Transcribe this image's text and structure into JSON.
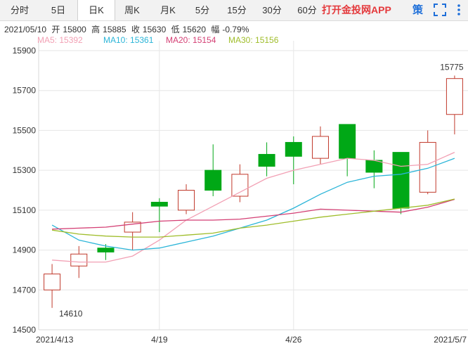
{
  "tabs": [
    {
      "label": "分时",
      "active": false
    },
    {
      "label": "5日",
      "active": false
    },
    {
      "label": "日K",
      "active": true
    },
    {
      "label": "周K",
      "active": false
    },
    {
      "label": "月K",
      "active": false
    },
    {
      "label": "5分",
      "active": false
    },
    {
      "label": "15分",
      "active": false
    },
    {
      "label": "30分",
      "active": false
    },
    {
      "label": "60分",
      "active": false
    }
  ],
  "promo_label": "打开金投网APP",
  "side_icon_text": "策",
  "info": {
    "date": "2021/05/10",
    "open_label": "开",
    "open": "15800",
    "high_label": "高",
    "high": "15885",
    "close_label": "收",
    "close": "15630",
    "low_label": "低",
    "low": "15620",
    "change_label": "幅",
    "change": "-0.79%"
  },
  "ma_legend": [
    {
      "label": "MA5: 15392",
      "color": "#f2a0b4"
    },
    {
      "label": "MA10: 15361",
      "color": "#2bb5d8"
    },
    {
      "label": "MA20: 15154",
      "color": "#d43f74"
    },
    {
      "label": "MA30: 15156",
      "color": "#9fbd2a"
    }
  ],
  "colors": {
    "up": "#c0392b",
    "down": "#00a816",
    "grid": "#e6e6e6",
    "axis_text": "#333333"
  },
  "chart_data": {
    "type": "candlestick",
    "ylim": [
      14500,
      15900
    ],
    "yticks": [
      14500,
      14700,
      14900,
      15100,
      15300,
      15500,
      15700,
      15900
    ],
    "dates": [
      "2021/4/13",
      "2021/4/14",
      "2021/4/15",
      "2021/4/16",
      "2021/4/19",
      "2021/4/20",
      "2021/4/21",
      "2021/4/22",
      "2021/4/23",
      "2021/4/26",
      "2021/4/27",
      "2021/4/28",
      "2021/4/29",
      "2021/4/30",
      "2021/5/6",
      "2021/5/7"
    ],
    "xticks": [
      {
        "index": 0,
        "label": "2021/4/13"
      },
      {
        "index": 4,
        "label": "4/19"
      },
      {
        "index": 9,
        "label": "4/26"
      },
      {
        "index": 15,
        "label": "2021/5/7"
      }
    ],
    "candles": [
      {
        "open": 14700,
        "close": 14780,
        "high": 14830,
        "low": 14610
      },
      {
        "open": 14820,
        "close": 14880,
        "high": 14920,
        "low": 14760
      },
      {
        "open": 14910,
        "close": 14890,
        "high": 14930,
        "low": 14850
      },
      {
        "open": 14990,
        "close": 15040,
        "high": 15090,
        "low": 14900
      },
      {
        "open": 15140,
        "close": 15120,
        "high": 15160,
        "low": 14990
      },
      {
        "open": 15100,
        "close": 15200,
        "high": 15230,
        "low": 15080
      },
      {
        "open": 15300,
        "close": 15200,
        "high": 15430,
        "low": 15170
      },
      {
        "open": 15170,
        "close": 15280,
        "high": 15330,
        "low": 15140
      },
      {
        "open": 15380,
        "close": 15320,
        "high": 15440,
        "low": 15270
      },
      {
        "open": 15440,
        "close": 15370,
        "high": 15470,
        "low": 15230
      },
      {
        "open": 15360,
        "close": 15470,
        "high": 15520,
        "low": 15330
      },
      {
        "open": 15530,
        "close": 15360,
        "high": 15530,
        "low": 15270
      },
      {
        "open": 15350,
        "close": 15290,
        "high": 15400,
        "low": 15210
      },
      {
        "open": 15390,
        "close": 15110,
        "high": 15390,
        "low": 15080
      },
      {
        "open": 15190,
        "close": 15440,
        "high": 15500,
        "low": 15180
      },
      {
        "open": 15580,
        "close": 15760,
        "high": 15775,
        "low": 15480
      }
    ],
    "series": [
      {
        "name": "MA5",
        "values": [
          14850,
          14840,
          14840,
          14870,
          14950,
          15050,
          15120,
          15190,
          15260,
          15300,
          15330,
          15360,
          15350,
          15320,
          15330,
          15390
        ]
      },
      {
        "name": "MA10",
        "values": [
          15025,
          14950,
          14920,
          14900,
          14910,
          14940,
          14970,
          15010,
          15050,
          15110,
          15180,
          15240,
          15270,
          15280,
          15310,
          15360
        ]
      },
      {
        "name": "MA20",
        "values": [
          15005,
          15010,
          15015,
          15030,
          15045,
          15050,
          15050,
          15055,
          15070,
          15085,
          15105,
          15100,
          15095,
          15090,
          15115,
          15154
        ]
      },
      {
        "name": "MA30",
        "values": [
          15000,
          14980,
          14970,
          14965,
          14965,
          14975,
          14985,
          15010,
          15025,
          15045,
          15065,
          15080,
          15095,
          15110,
          15125,
          15156
        ]
      }
    ],
    "annotations": [
      {
        "index": 15,
        "value": 15775,
        "label": "15775",
        "kind": "high"
      },
      {
        "index": 0,
        "value": 14610,
        "label": "14610",
        "kind": "low"
      }
    ]
  }
}
